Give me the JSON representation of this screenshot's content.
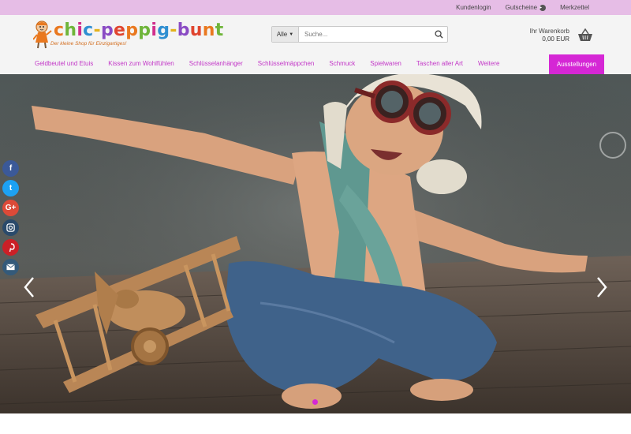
{
  "topbar": {
    "login": "Kundenlogin",
    "vouchers": "Gutscheine",
    "wishlist": "Merkzettel"
  },
  "logo": {
    "title": "chic-peppig-bunt",
    "tagline": "Der kleine Shop für Einzigartiges!"
  },
  "search": {
    "category": "Alle",
    "placeholder": "Suche..."
  },
  "cart": {
    "label": "Ihr Warenkorb",
    "amount": "0,00 EUR"
  },
  "nav": {
    "items": [
      "Geldbeutel und Etuis",
      "Kissen zum Wohlfühlen",
      "Schlüsselanhänger",
      "Schlüsselmäppchen",
      "Schmuck",
      "Spielwaren",
      "Taschen aller Art",
      "Weitere"
    ],
    "cta": "Ausstellungen"
  },
  "social": {
    "facebook": "f",
    "twitter": "t",
    "googleplus": "G+"
  },
  "colors": {
    "accent": "#d527d5",
    "nav_text": "#c235c7",
    "topbar": "#e6bde6",
    "facebook": "#3b5998",
    "twitter": "#1da1f2",
    "googleplus": "#dc4a38",
    "instagram": "#2a4a6b",
    "pinterest": "#cb2027",
    "mail": "#345a7a"
  }
}
